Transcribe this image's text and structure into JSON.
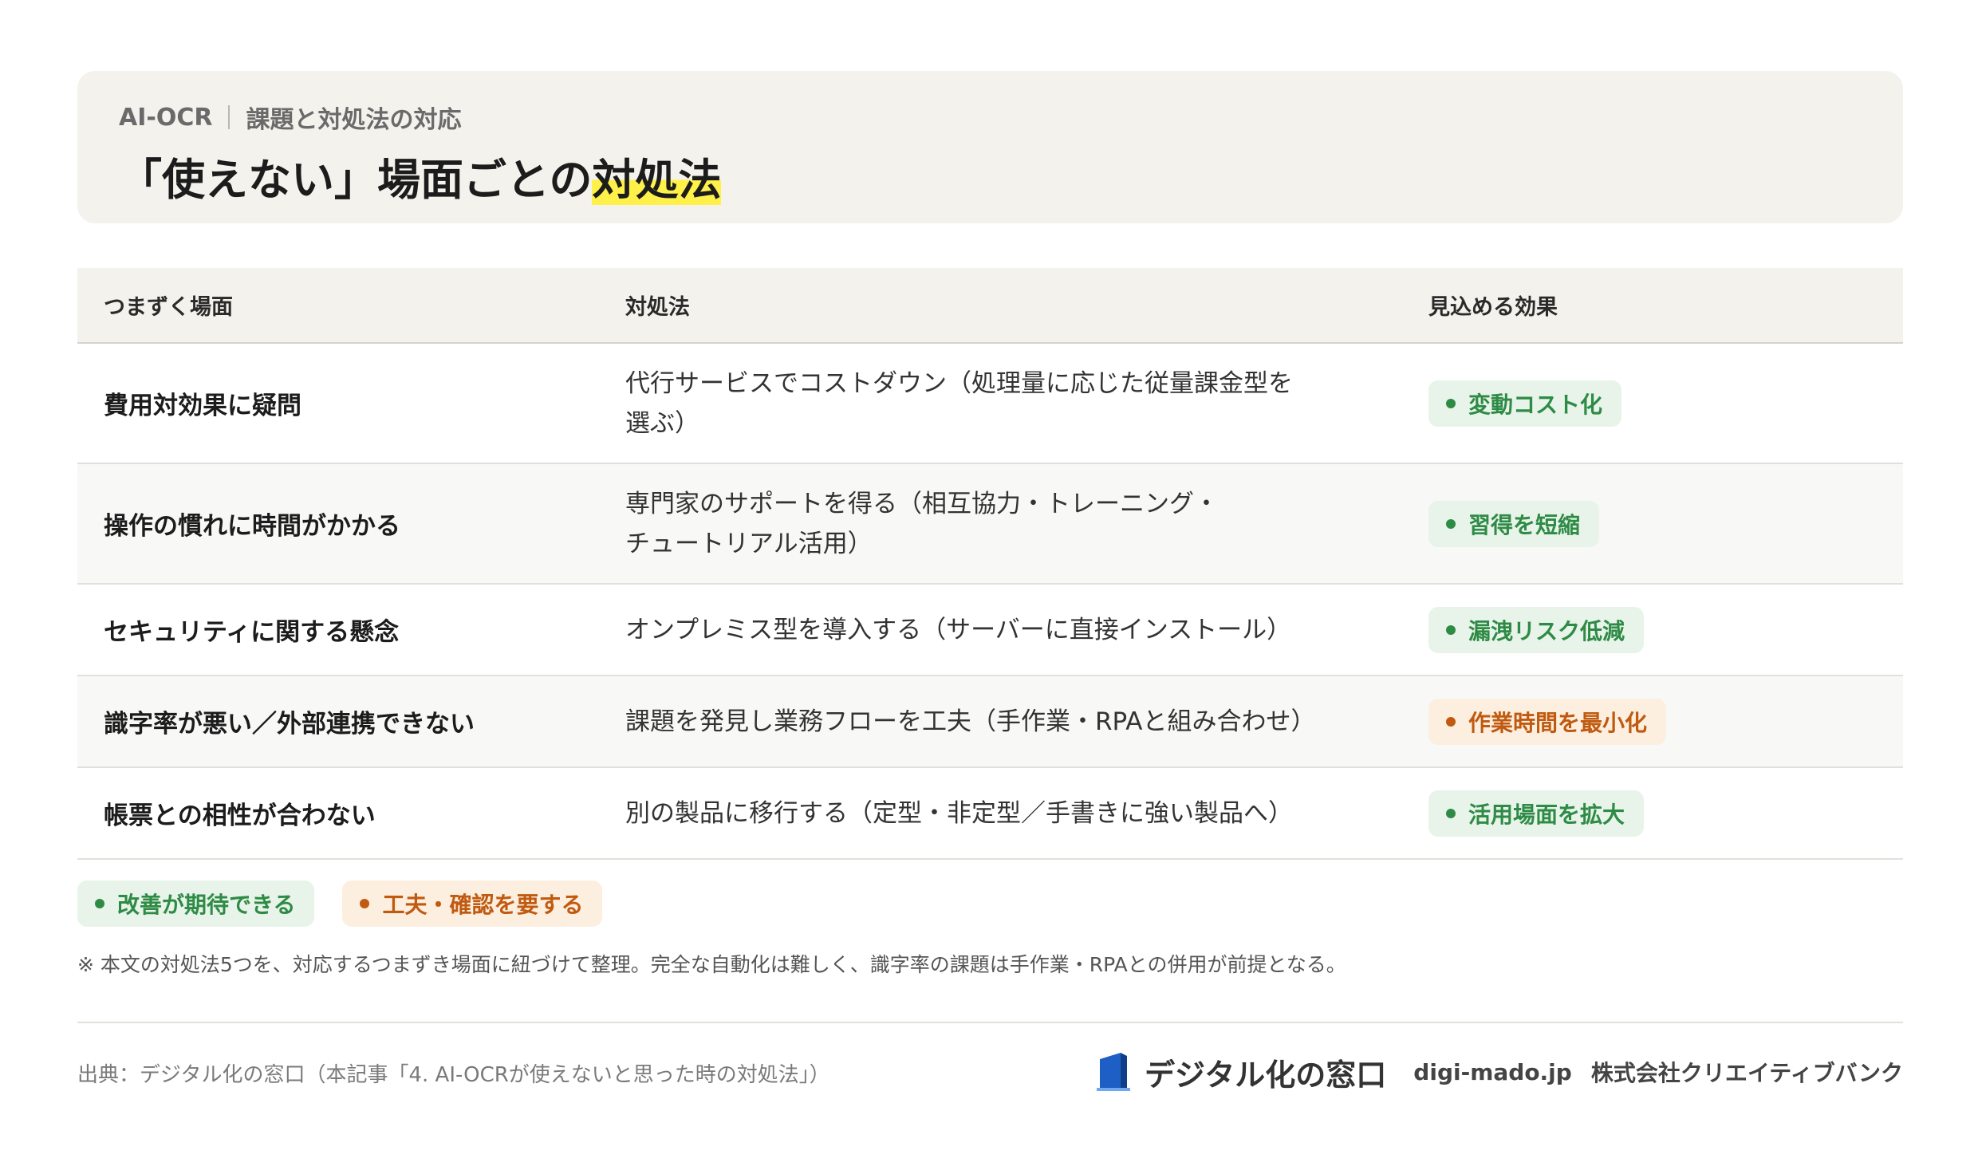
{
  "header": {
    "category": "AI-OCR",
    "subtitle": "課題と対処法の対応",
    "title_main": "「使えない」場面ごとの",
    "title_highlight": "対処法"
  },
  "table": {
    "columns": [
      "つまずく場面",
      "対処法",
      "見込める効果"
    ],
    "rows": [
      {
        "scene": "費用対効果に疑問",
        "remedy_lines": [
          "代行サービスでコストダウン（処理量に応じた従量課金型を",
          "選ぶ）"
        ],
        "effect": "変動コスト化",
        "effect_type": "improvement",
        "effect_color": "#2e8b45"
      },
      {
        "scene": "操作の慣れに時間がかかる",
        "remedy_lines": [
          "専門家のサポートを得る（相互協力・トレーニング・",
          "チュートリアル活用）"
        ],
        "effect": "習得を短縮",
        "effect_type": "improvement",
        "effect_color": "#2e8b45"
      },
      {
        "scene": "セキュリティに関する懸念",
        "remedy_lines": [
          "オンプレミス型を導入する（サーバーに直接インストール）"
        ],
        "effect": "漏洩リスク低減",
        "effect_type": "improvement",
        "effect_color": "#2e8b45"
      },
      {
        "scene": "識字率が悪い／外部連携できない",
        "remedy_lines": [
          "課題を発見し業務フローを工夫（手作業・RPAと組み合わせ）"
        ],
        "effect": "作業時間を最小化",
        "effect_type": "needs-effort",
        "effect_color": "#c05a10"
      },
      {
        "scene": "帳票との相性が合わない",
        "remedy_lines": [
          "別の製品に移行する（定型・非定型／手書きに強い製品へ）"
        ],
        "effect": "活用場面を拡大",
        "effect_type": "improvement",
        "effect_color": "#2e8b45"
      }
    ]
  },
  "legend": {
    "improvement": "改善が期待できる",
    "needs_effort": "工夫・確認を要する"
  },
  "note": "※ 本文の対処法5つを、対応するつまずき場面に紐づけて整理。完全な自動化は難しく、識字率の課題は手作業・RPAとの併用が前提となる。",
  "footer": {
    "source": "出典：デジタル化の窓口（本記事「4. AI-OCRが使えないと思った時の対処法」）",
    "brand_name": "デジタル化の窓口",
    "domain": "digi-mado.jp",
    "company": "株式会社クリエイティブバンク",
    "logo_icon": "window-door-icon"
  },
  "colors": {
    "header_bg": "#f4f2ec",
    "highlight": "#fff04a",
    "green": "#2e8b45",
    "green_bg": "#e8f3ea",
    "orange": "#c05a10",
    "orange_bg": "#fcefdf",
    "logo_blue": "#1d5fc4"
  }
}
